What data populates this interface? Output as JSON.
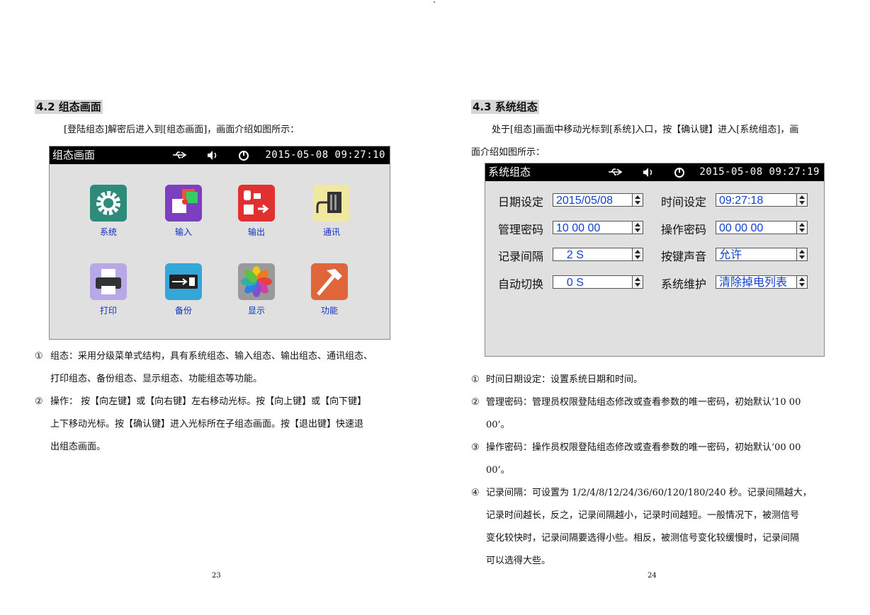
{
  "left_page": {
    "heading": "4.2 组态画面",
    "intro": "[登陆组态]解密后进入到[组态画面]，画面介绍如图所示：",
    "screen": {
      "title": "组态画面",
      "datetime": "2015-05-08  09:27:10",
      "tiles": [
        {
          "label": "系统",
          "icon": "gear-icon",
          "color": "#2e8b7a"
        },
        {
          "label": "输入",
          "icon": "input-icon",
          "color": "#7b3fbf"
        },
        {
          "label": "输出",
          "icon": "output-icon",
          "color": "#e03030"
        },
        {
          "label": "通讯",
          "icon": "serial-port-icon",
          "color": "#f0e8a0"
        },
        {
          "label": "打印",
          "icon": "printer-icon",
          "color": "#b9a8e6"
        },
        {
          "label": "备份",
          "icon": "usb-icon",
          "color": "#35a6d8"
        },
        {
          "label": "显示",
          "icon": "photos-icon",
          "color": "#9a9a9a"
        },
        {
          "label": "功能",
          "icon": "hammer-icon",
          "color": "#e0653a"
        }
      ]
    },
    "notes": [
      {
        "num": "①",
        "lines": [
          "组态：采用分级菜单式结构，具有系统组态、输入组态、输出组态、通讯组态、",
          "打印组态、备份组态、显示组态、功能组态等功能。"
        ]
      },
      {
        "num": "②",
        "lines": [
          "操作：  按【向左键】或【向右键】左右移动光标。按【向上键】或【向下键】",
          "上下移动光标。按【确认键】进入光标所在子组态画面。按【退出键】快速退",
          "出组态画面。"
        ]
      }
    ],
    "page_number": "23"
  },
  "right_page": {
    "heading": "4.3 系统组态",
    "intro_lines": [
      "处于[组态]画面中移动光标到[系统]入口，按【确认键】进入[系统组态]，画",
      "面介绍如图所示："
    ],
    "screen": {
      "title": "系统组态",
      "datetime": "2015-05-08  09:27:19",
      "fields": [
        {
          "label": "日期设定",
          "value": "2015/05/08"
        },
        {
          "label": "时间设定",
          "value": "09:27:18"
        },
        {
          "label": "管理密码",
          "value": "10 00 00"
        },
        {
          "label": "操作密码",
          "value": "00 00 00"
        },
        {
          "label": "记录间隔",
          "value": "  2 S"
        },
        {
          "label": "按键声音",
          "value": "允许"
        },
        {
          "label": "自动切换",
          "value": "  0 S"
        },
        {
          "label": "系统维护",
          "value": "清除掉电列表"
        }
      ]
    },
    "notes": [
      {
        "num": "①",
        "lines": [
          "时间日期设定：设置系统日期和时间。"
        ]
      },
      {
        "num": "②",
        "lines": [
          "管理密码：管理员权限登陆组态修改或查看参数的唯一密码，初始默认’10 00",
          "00’。"
        ]
      },
      {
        "num": "③",
        "lines": [
          "操作密码：操作员权限登陆组态修改或查看参数的唯一密码，初始默认’00 00",
          "00’。"
        ]
      },
      {
        "num": "④",
        "lines": [
          "记录间隔：可设置为 1/2/4/8/12/24/36/60/120/180/240 秒。记录间隔越大，",
          "记录时间越长，反之，记录间隔越小，记录时间越短。一般情况下，被测信号",
          "变化较快时，记录间隔要选得小些。相反，被测信号变化较缓慢时，记录间隔",
          "可以选得大些。"
        ]
      }
    ],
    "page_number": "24"
  },
  "status_icons": {
    "usb": "⇠",
    "sound": "◀)",
    "power": "⏻"
  }
}
